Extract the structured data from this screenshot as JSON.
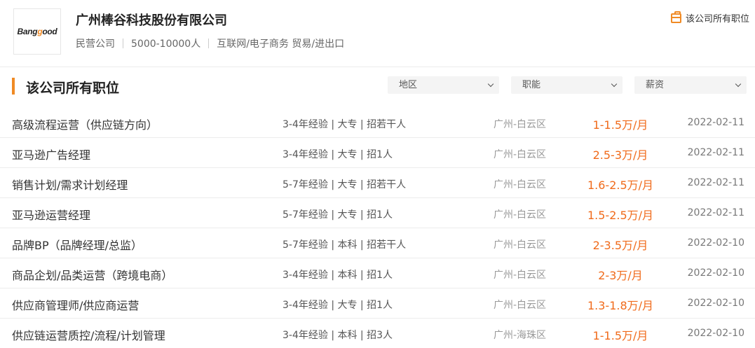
{
  "company": {
    "logo": {
      "prefix": "Bang",
      "accent": "g",
      "suffix": "ood"
    },
    "name": "广州棒谷科技股份有限公司",
    "type": "民营公司",
    "size": "5000-10000人",
    "industry": "互联网/电子商务 贸易/进出口",
    "all_jobs_link": "该公司所有职位"
  },
  "section": {
    "title": "该公司所有职位",
    "filters": {
      "region": "地区",
      "function": "职能",
      "salary": "薪资"
    }
  },
  "jobs": [
    {
      "title": "高级流程运营（供应链方向）",
      "req": "3-4年经验 | 大专 | 招若干人",
      "loc": "广州-白云区",
      "salary": "1-1.5万/月",
      "date": "2022-02-11"
    },
    {
      "title": "亚马逊广告经理",
      "req": "3-4年经验 | 大专 | 招1人",
      "loc": "广州-白云区",
      "salary": "2.5-3万/月",
      "date": "2022-02-11"
    },
    {
      "title": "销售计划/需求计划经理",
      "req": "5-7年经验 | 大专 | 招若干人",
      "loc": "广州-白云区",
      "salary": "1.6-2.5万/月",
      "date": "2022-02-11"
    },
    {
      "title": "亚马逊运营经理",
      "req": "5-7年经验 | 大专 | 招1人",
      "loc": "广州-白云区",
      "salary": "1.5-2.5万/月",
      "date": "2022-02-11"
    },
    {
      "title": "品牌BP（品牌经理/总监）",
      "req": "5-7年经验 | 本科 | 招若干人",
      "loc": "广州-白云区",
      "salary": "2-3.5万/月",
      "date": "2022-02-10"
    },
    {
      "title": "商品企划/品类运营（跨境电商）",
      "req": "3-4年经验 | 本科 | 招1人",
      "loc": "广州-白云区",
      "salary": "2-3万/月",
      "date": "2022-02-10"
    },
    {
      "title": "供应商管理师/供应商运营",
      "req": "3-4年经验 | 大专 | 招1人",
      "loc": "广州-白云区",
      "salary": "1.3-1.8万/月",
      "date": "2022-02-10"
    },
    {
      "title": "供应链运营质控/流程/计划管理",
      "req": "3-4年经验 | 本科 | 招3人",
      "loc": "广州-海珠区",
      "salary": "1-1.5万/月",
      "date": "2022-02-10"
    }
  ],
  "colors": {
    "accent": "#f08a24",
    "salary": "#f06a1a"
  },
  "icons": {
    "all_jobs": "briefcase-icon",
    "dropdown": "chevron-down-icon"
  }
}
